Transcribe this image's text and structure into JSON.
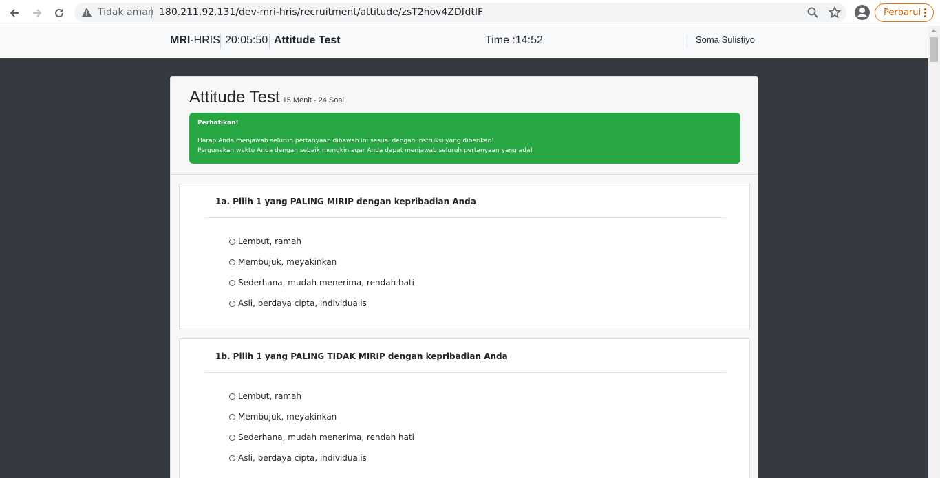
{
  "browser": {
    "security_label": "Tidak aman",
    "url": "180.211.92.131/dev-mri-hris/recruitment/attitude/zsT2hov4ZDfdtIF",
    "update_label": "Perbarui"
  },
  "header": {
    "brand_bold": "MRI",
    "brand_rest": "-HRIS",
    "clock": "20:05:50",
    "page_name": "Attitude Test",
    "timer": "Time :14:52",
    "user_name": "Soma Sulistiyo"
  },
  "test": {
    "title": "Attitude Test",
    "subtitle": "15 Menit - 24 Soal",
    "alert_title": "Perhatikan!",
    "alert_line1": "Harap Anda menjawab seluruh pertanyaan dibawah ini sesuai dengan instruksi yang diberikan!",
    "alert_line2": "Pergunakan waktu Anda dengan sebaik mungkin agar Anda dapat menjawab seluruh pertanyaan yang ada!"
  },
  "questions": [
    {
      "title": "1a. Pilih 1 yang PALING MIRIP dengan kepribadian Anda",
      "options": [
        "Lembut, ramah",
        "Membujuk, meyakinkan",
        "Sederhana, mudah menerima, rendah hati",
        "Asli, berdaya cipta, individualis"
      ]
    },
    {
      "title": "1b. Pilih 1 yang PALING TIDAK MIRIP dengan kepribadian Anda",
      "options": [
        "Lembut, ramah",
        "Membujuk, meyakinkan",
        "Sederhana, mudah menerima, rendah hati",
        "Asli, berdaya cipta, individualis"
      ]
    }
  ]
}
